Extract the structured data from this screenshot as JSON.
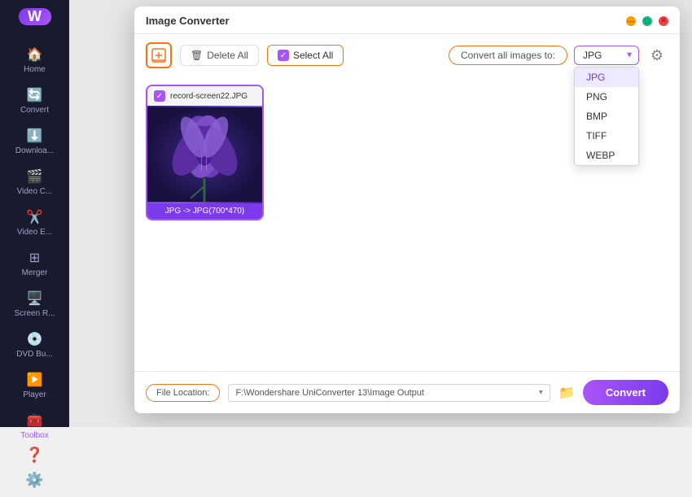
{
  "sidebar": {
    "logo_text": "W",
    "items": [
      {
        "id": "home",
        "label": "Home",
        "icon": "🏠"
      },
      {
        "id": "convert",
        "label": "Convert",
        "icon": "🔄"
      },
      {
        "id": "download",
        "label": "Downloa...",
        "icon": "⬇️"
      },
      {
        "id": "video-c",
        "label": "Video C...",
        "icon": "🎬"
      },
      {
        "id": "video-e",
        "label": "Video E...",
        "icon": "✂️"
      },
      {
        "id": "merger",
        "label": "Merger",
        "icon": "⊞"
      },
      {
        "id": "screen",
        "label": "Screen R...",
        "icon": "🖥️"
      },
      {
        "id": "dvd",
        "label": "DVD Bu...",
        "icon": "💿"
      },
      {
        "id": "player",
        "label": "Player",
        "icon": "▶️"
      },
      {
        "id": "toolbox",
        "label": "Toolbox",
        "icon": "🧰",
        "active": true
      }
    ],
    "bottom": [
      {
        "id": "help",
        "icon": "❓"
      },
      {
        "id": "settings",
        "icon": "⚙️"
      }
    ]
  },
  "dialog": {
    "title": "Image Converter",
    "controls": {
      "minimize": "—",
      "maximize": "□",
      "close": "✕"
    }
  },
  "toolbar": {
    "add_icon": "+",
    "delete_all_label": "Delete All",
    "select_all_label": "Select All",
    "convert_all_label": "Convert all images to:",
    "settings_icon": "⚙"
  },
  "format_dropdown": {
    "selected": "JPG",
    "options": [
      {
        "value": "JPG",
        "label": "JPG"
      },
      {
        "value": "PNG",
        "label": "PNG"
      },
      {
        "value": "BMP",
        "label": "BMP"
      },
      {
        "value": "TIFF",
        "label": "TIFF"
      },
      {
        "value": "WEBP",
        "label": "WEBP"
      }
    ]
  },
  "image_card": {
    "filename": "record-screen22.JPG",
    "conversion_info": "JPG -> JPG(700*470)",
    "checked": true
  },
  "footer": {
    "file_location_label": "File Location:",
    "file_path": "F:\\Wondershare UniConverter 13\\Image Output",
    "convert_button": "Convert"
  }
}
